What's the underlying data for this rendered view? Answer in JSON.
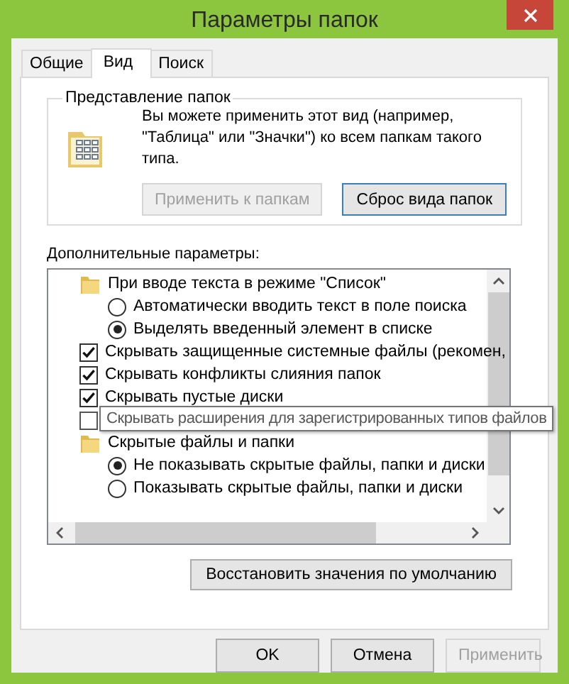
{
  "window": {
    "title": "Параметры папок"
  },
  "tabs": [
    {
      "label": "Общие",
      "selected": false
    },
    {
      "label": "Вид",
      "selected": true
    },
    {
      "label": "Поиск",
      "selected": false
    }
  ],
  "folder_views": {
    "title": "Представление папок",
    "description": "Вы можете применить этот вид (например, \"Таблица\" или \"Значки\") ко всем папкам такого типа.",
    "buttons": [
      {
        "label": "Применить к папкам",
        "disabled": true
      },
      {
        "label": "Сброс вида папок",
        "disabled": false
      }
    ]
  },
  "advanced": {
    "label": "Дополнительные параметры:",
    "items": [
      {
        "kind": "folder",
        "label": "При вводе текста в режиме \"Список\"",
        "children": [
          {
            "kind": "radio",
            "label": "Автоматически вводить текст в поле поиска",
            "selected": false
          },
          {
            "kind": "radio",
            "label": "Выделять введенный элемент в списке",
            "selected": true
          }
        ]
      },
      {
        "kind": "checkbox",
        "label": "Скрывать защищенные системные файлы (рекомен,",
        "checked": true
      },
      {
        "kind": "checkbox",
        "label": "Скрывать конфликты слияния папок",
        "checked": true
      },
      {
        "kind": "checkbox",
        "label": "Скрывать пустые диски",
        "checked": true
      },
      {
        "kind": "checkbox",
        "checked": false,
        "tooltip": "Скрывать расширения для зарегистрированных типов файлов"
      },
      {
        "kind": "folder",
        "label": "Скрытые файлы и папки",
        "children": [
          {
            "kind": "radio",
            "label": "Не показывать скрытые файлы, папки и диски",
            "selected": true
          },
          {
            "kind": "radio",
            "label": "Показывать скрытые файлы, папки и диски",
            "selected": false
          }
        ]
      }
    ]
  },
  "restore_button": "Восстановить значения по умолчанию",
  "buttons": [
    {
      "label": "OK",
      "disabled": false
    },
    {
      "label": "Отмена",
      "disabled": false
    },
    {
      "label": "Применить",
      "disabled": true
    }
  ]
}
